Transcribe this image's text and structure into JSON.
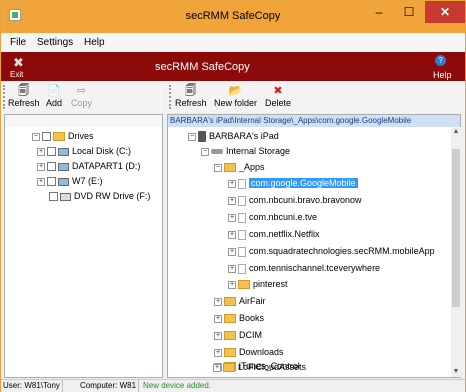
{
  "window": {
    "title": "secRMM SafeCopy",
    "minimize": "–",
    "maximize": "☐",
    "close": "✕"
  },
  "menu": [
    "File",
    "Settings",
    "Help"
  ],
  "header": {
    "exit_label": "Exit",
    "exit_icon": "✖",
    "app_name": "secRMM SafeCopy",
    "help_label": "Help",
    "help_icon": "?"
  },
  "toolbar_left": {
    "refresh": {
      "label": "Refresh",
      "icon": "🗐"
    },
    "add": {
      "label": "Add",
      "icon": "📄"
    },
    "copy": {
      "label": "Copy",
      "icon": "⇨"
    }
  },
  "toolbar_right": {
    "refresh": {
      "label": "Refresh",
      "icon": "🗐"
    },
    "new_folder": {
      "label": "New folder",
      "icon": "📂"
    },
    "delete": {
      "label": "Delete",
      "icon": "✖"
    }
  },
  "left_tree": {
    "root": "Drives",
    "drives": [
      "Local Disk (C:)",
      "DATAPART1 (D:)",
      "W7 (E:)",
      "DVD RW Drive (F:)"
    ]
  },
  "right_pane": {
    "path": "BARBARA's iPad\\Internal Storage\\_Apps\\com.google.GoogleMobile",
    "device": "BARBARA's iPad",
    "storage": "Internal Storage",
    "apps_folder": "_Apps",
    "apps": [
      "com.google.GoogleMobile",
      "com.nbcuni.bravo.bravonow",
      "com.nbcuni.e.tve",
      "com.netflix.Netflix",
      "com.squadratechnologies.secRMM.mobileApp",
      "com.tennischannel.tceverywhere",
      "pinterest"
    ],
    "folders": [
      "AirFair",
      "Books",
      "DCIM",
      "Downloads",
      "iTunes_Control",
      "LoFiCloudAssets"
    ]
  },
  "status": {
    "user": "User: W81\\Tony",
    "computer": "Computer: W81",
    "message": "New device added."
  },
  "colors": {
    "titlebar": "#f0a43a",
    "header": "#8d0a0a",
    "selection": "#3399ff",
    "status_ok": "#2e8b2e"
  }
}
